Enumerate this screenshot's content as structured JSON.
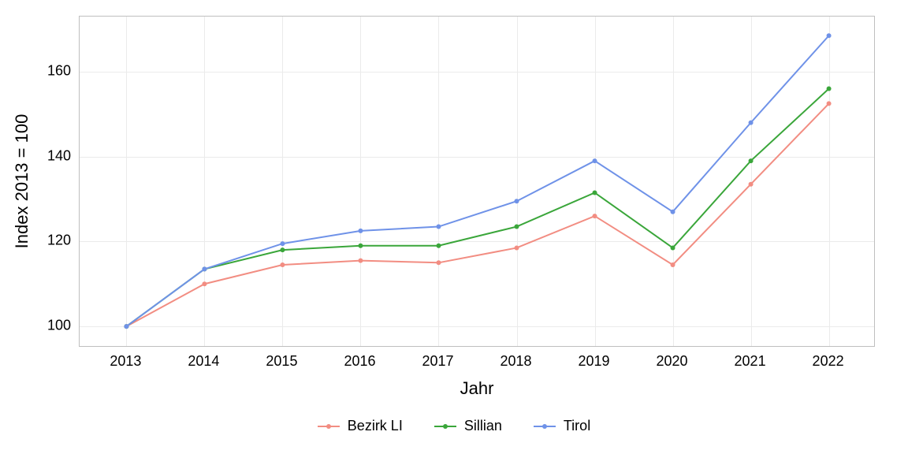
{
  "chart_data": {
    "type": "line",
    "title": "",
    "xlabel": "Jahr",
    "ylabel": "Index  2013  = 100",
    "x": [
      2013,
      2014,
      2015,
      2016,
      2017,
      2018,
      2019,
      2020,
      2021,
      2022
    ],
    "x_ticks": [
      "2013",
      "2014",
      "2015",
      "2016",
      "2017",
      "2018",
      "2019",
      "2020",
      "2021",
      "2022"
    ],
    "y_ticks": [
      100,
      120,
      140,
      160
    ],
    "xlim": [
      2012.4,
      2022.6
    ],
    "ylim": [
      95,
      173
    ],
    "series": [
      {
        "name": "Bezirk LI",
        "color": "#f28d82",
        "values": [
          100,
          110,
          114.5,
          115.5,
          115,
          118.5,
          126,
          114.5,
          133.5,
          152.5
        ]
      },
      {
        "name": "Sillian",
        "color": "#3aa63a",
        "values": [
          100,
          113.5,
          118,
          119,
          119,
          123.5,
          131.5,
          118.5,
          139,
          156
        ]
      },
      {
        "name": "Tirol",
        "color": "#6f92e8",
        "values": [
          100,
          113.5,
          119.5,
          122.5,
          123.5,
          129.5,
          139,
          127,
          148,
          168.5
        ]
      }
    ],
    "legend_position": "bottom",
    "grid": true
  }
}
